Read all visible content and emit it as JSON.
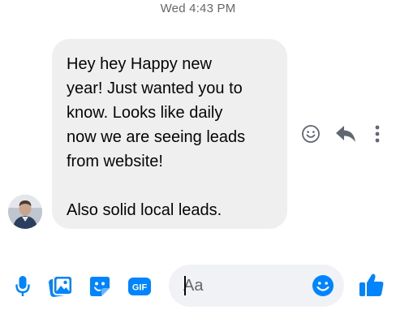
{
  "conversation": {
    "timestamp": "Wed 4:43 PM"
  },
  "message": {
    "text": "Hey hey Happy new\nyear! Just wanted you to\nknow. Looks like daily\nnow we are seeing leads\nfrom website!\n\nAlso solid local leads."
  },
  "composer": {
    "placeholder": "Aa"
  },
  "icons": {
    "message_actions": [
      "smiley-icon",
      "reply-icon",
      "more-icon"
    ],
    "composer_tools": [
      "microphone-icon",
      "image-icon",
      "sticker-icon",
      "gif-icon",
      "emoji-icon",
      "thumbs-up-icon"
    ],
    "gif_label": "GIF"
  },
  "colors": {
    "accent": "#0084ff",
    "bubble_bg": "#efefef",
    "text": "#050505",
    "muted": "#65676b",
    "input_bg": "#f0f2f5"
  }
}
